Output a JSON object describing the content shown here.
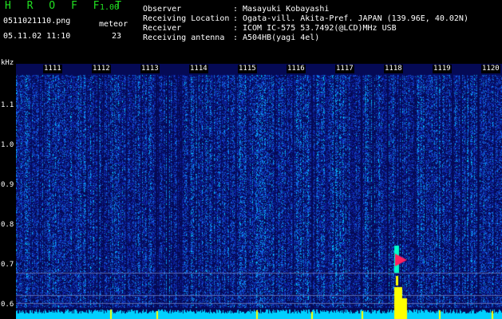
{
  "app": {
    "title": "H R O F F T",
    "version": "1.00",
    "filename": "0511021110.png",
    "datetime": "05.11.02 11:10",
    "meteor_label": "meteor",
    "meteor_count": "23"
  },
  "info": {
    "separator": ":",
    "observer_label": "Observer",
    "observer_value": "Masayuki Kobayashi",
    "location_label": "Receiving Location",
    "location_value": "Ogata-vill. Akita-Pref. JAPAN (139.96E, 40.02N)",
    "receiver_label": "Receiver",
    "receiver_value": "ICOM IC-575 53.7492(@LCD)MHz USB",
    "antenna_label": "Receiving antenna",
    "antenna_value": "A504HB(yagi 4el)"
  },
  "spectrogram": {
    "unit_label": "kHz",
    "y_ticks": [
      "1.1",
      "1.0",
      "0.9",
      "0.8",
      "0.7",
      "0.6"
    ],
    "time_labels": [
      "1111",
      "1112",
      "1113",
      "1114",
      "1115",
      "1116",
      "1117",
      "1118",
      "1119",
      "1120"
    ],
    "colors": {
      "background": "#000000",
      "noise": "#0a1a9a",
      "signal": "#00d0ff",
      "meteor": "#ff2060",
      "level": "#ffff00",
      "grid": "#5a6ab0"
    }
  }
}
